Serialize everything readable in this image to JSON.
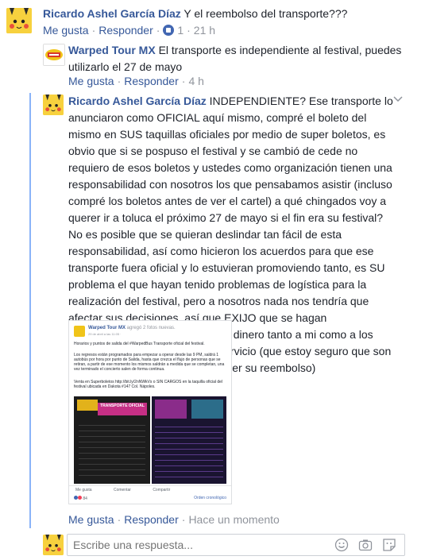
{
  "comment1": {
    "author": "Ricardo Ashel García Díaz",
    "text": "Y el reembolso del transporte???",
    "like_label": "Me gusta",
    "reply_label": "Responder",
    "reaction_count": "1",
    "time": "21 h"
  },
  "reply1": {
    "author": "Warped Tour MX",
    "text": "El transporte es independiente al festival, puedes utilizarlo el 27 de mayo",
    "like_label": "Me gusta",
    "reply_label": "Responder",
    "time": "4 h"
  },
  "reply2": {
    "author": "Ricardo Ashel García Díaz",
    "text": "INDEPENDIENTE? Ese transporte lo anunciaron como OFICIAL aquí mismo, compré el boleto del mismo en SUS taquillas oficiales por medio de super boletos, es obvio que si se pospuso el festival y se cambió de cede no requiero de esos boletos y ustedes como organización tienen una responsabilidad con nosotros los que pensabamos asistir (incluso compré los boletos antes de ver el cartel) a qué chingados voy a querer ir a toluca el próximo 27 de mayo si el fin era su festival? No es posible que se quieran deslindar tan fácil de esta responsabilidad, así como hicieron los acuerdos para que ese transporte fuera oficial y lo estuvieran promoviendo tanto, es SU problema el que hayan tenido problemas de logística para la realización del festival, pero a nosotros nada nos tendría que afectar sus decisiones, así que EXIJO que se hagan responsables y me devuelvan mi dinero tanto a mi como a los demás que pagamos por este servicio (que estoy seguro que son muchos y obviamente van a querer su reembolso)",
    "like_label": "Me gusta",
    "reply_label": "Responder",
    "time": "Hace un momento",
    "attachment": {
      "page_name": "Warped Tour MX",
      "action": "agregó 2 fotos nuevas.",
      "date": "29 de abril a las 11:05 · ",
      "body1": "Horarios y puntos de salida del #WarpedBus Transporte oficial del festival.",
      "body2": "Los regresos están programados para empezar a operar desde las 9 PM, saldrá 1 autobús por hora por punto de Salida, hasta que crezca el flujo de personas que se retiran, a partir de ese momento los mismos saldrán a medida que se completan, una vez terminado el concierto salen de forma continua.",
      "body3": "Venta en Superboletos http://bit.ly/2nNWkVs o SIN CARGOS en la taquilla oficial del festival ubicada en Dakota #147 Col. Nápoles.",
      "poster_title": "TRANSPORTE OFICIAL",
      "like": "Me gusta",
      "comment": "Comentar",
      "share": "Compartir",
      "reactions": "84",
      "order": "Orden cronológico"
    }
  },
  "reply_box": {
    "placeholder": "Escribe una respuesta..."
  }
}
